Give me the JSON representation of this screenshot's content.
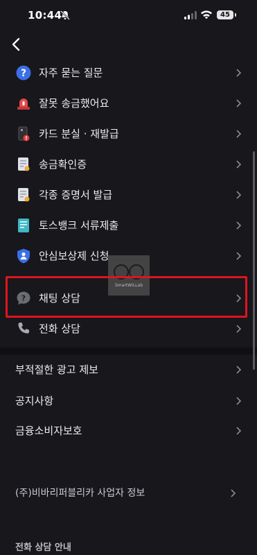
{
  "status_bar": {
    "time": "10:44",
    "battery": "45"
  },
  "menu": [
    {
      "label": "자주 묻는 질문",
      "icon": "question-circle-icon"
    },
    {
      "label": "잘못 송금했어요",
      "icon": "siren-icon"
    },
    {
      "label": "카드 분실 · 재발급",
      "icon": "card-alert-icon"
    },
    {
      "label": "송금확인증",
      "icon": "certificate-icon"
    },
    {
      "label": "각종 증명서 발급",
      "icon": "document-badge-icon"
    },
    {
      "label": "토스뱅크 서류제출",
      "icon": "document-submit-icon"
    },
    {
      "label": "안심보상제 신청",
      "icon": "shield-user-icon"
    },
    {
      "label": "채팅 상담",
      "icon": "chat-question-icon"
    },
    {
      "label": "전화 상담",
      "icon": "phone-icon"
    }
  ],
  "secondary": [
    {
      "label": "부적절한 광고 제보"
    },
    {
      "label": "공지사항"
    },
    {
      "label": "금융소비자보호"
    }
  ],
  "company_info": {
    "label": "(주)비바리퍼블리카 사업자 정보"
  },
  "phone_section_title": "전화 상담 안내",
  "watermark": {
    "text": "SmartWILLab"
  },
  "colors": {
    "background": "#17171c",
    "highlight": "#e0141d",
    "accent_blue": "#3b6fe8"
  }
}
